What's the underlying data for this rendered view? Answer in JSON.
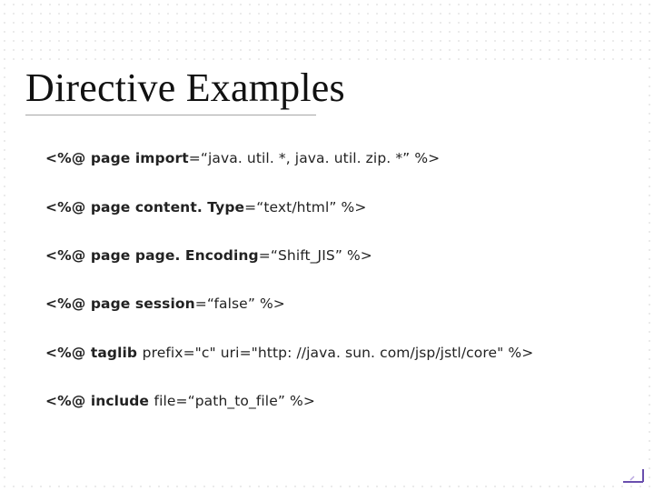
{
  "title": "Directive Examples",
  "lines": [
    {
      "segs": [
        {
          "t": "<%@ ",
          "b": true
        },
        {
          "t": "page ",
          "b": true
        },
        {
          "t": "import",
          "b": true
        },
        {
          "t": "=“java. util. *, java. util. zip. *” %>",
          "b": false
        }
      ]
    },
    {
      "segs": [
        {
          "t": "<%@ ",
          "b": true
        },
        {
          "t": "page content. Type",
          "b": true
        },
        {
          "t": "=“text/html” %>",
          "b": false
        }
      ]
    },
    {
      "segs": [
        {
          "t": "<%@ ",
          "b": true
        },
        {
          "t": "page page. Encoding",
          "b": true
        },
        {
          "t": "=“Shift_JIS” %>",
          "b": false
        }
      ]
    },
    {
      "segs": [
        {
          "t": "<%@ ",
          "b": true
        },
        {
          "t": "page session",
          "b": true
        },
        {
          "t": "=“false” %>",
          "b": false
        }
      ]
    },
    {
      "segs": [
        {
          "t": "<%@ ",
          "b": true
        },
        {
          "t": "taglib ",
          "b": true
        },
        {
          "t": "prefix=\"c\" uri=\"http: //java. sun. com/jsp/jstl/core\" %>",
          "b": false
        }
      ]
    },
    {
      "segs": [
        {
          "t": "<%@ ",
          "b": true
        },
        {
          "t": "include ",
          "b": true
        },
        {
          "t": "file=“path_to_file” %>",
          "b": false
        }
      ]
    }
  ]
}
